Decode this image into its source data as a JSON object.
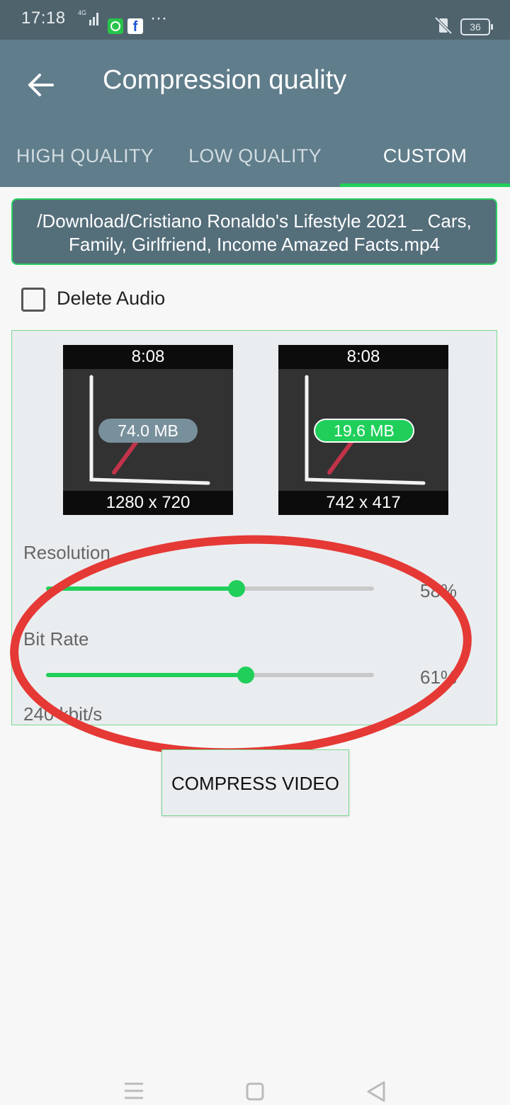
{
  "status_bar": {
    "time": "17:18",
    "network": "4G",
    "battery": "36",
    "icons": [
      "signal-icon",
      "whatsapp-icon",
      "facebook-icon",
      "more-icon",
      "vibrate-mute-icon",
      "battery-icon"
    ]
  },
  "app_bar": {
    "title": "Compression quality",
    "tabs": [
      {
        "label": "HIGH QUALITY",
        "active": false
      },
      {
        "label": "LOW QUALITY",
        "active": false
      },
      {
        "label": "CUSTOM",
        "active": true
      }
    ]
  },
  "file": {
    "path": "/Download/Cristiano Ronaldo's Lifestyle 2021 _ Cars, Family, Girlfriend, Income Amazed Facts.mp4"
  },
  "delete_audio": {
    "label": "Delete Audio",
    "checked": false
  },
  "preview": {
    "original": {
      "duration": "8:08",
      "size": "74.0 MB",
      "resolution": "1280 x 720"
    },
    "compressed": {
      "duration": "8:08",
      "size": "19.6 MB",
      "resolution": "742 x 417"
    }
  },
  "sliders": {
    "resolution": {
      "label": "Resolution",
      "percent_text": "58%",
      "value": 0.58
    },
    "bitrate": {
      "label": "Bit Rate",
      "percent_text": "61%",
      "value": 0.61,
      "rate_text": "240 kbit/s"
    }
  },
  "actions": {
    "compress_label": "COMPRESS VIDEO"
  },
  "colors": {
    "accent": "#1fcf5a",
    "app_bar": "#607d8b",
    "status_bar": "#4f636d",
    "annotation": "#e53935"
  }
}
